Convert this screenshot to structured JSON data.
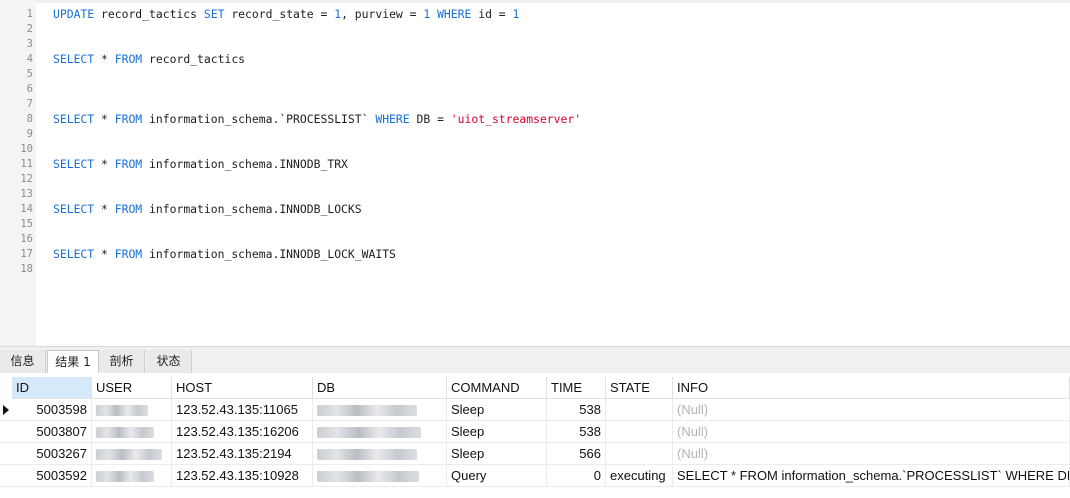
{
  "editor": {
    "lines": [
      {
        "n": "1",
        "tokens": [
          {
            "t": "UPDATE",
            "c": "kw"
          },
          {
            "t": " record_tactics ",
            "c": ""
          },
          {
            "t": "SET",
            "c": "kw"
          },
          {
            "t": " record_state = ",
            "c": ""
          },
          {
            "t": "1",
            "c": "num"
          },
          {
            "t": ", purview = ",
            "c": ""
          },
          {
            "t": "1",
            "c": "num"
          },
          {
            "t": " ",
            "c": ""
          },
          {
            "t": "WHERE",
            "c": "kw"
          },
          {
            "t": " id = ",
            "c": ""
          },
          {
            "t": "1",
            "c": "num"
          }
        ]
      },
      {
        "n": "2",
        "tokens": []
      },
      {
        "n": "3",
        "tokens": []
      },
      {
        "n": "4",
        "tokens": [
          {
            "t": "SELECT",
            "c": "kw"
          },
          {
            "t": " * ",
            "c": ""
          },
          {
            "t": "FROM",
            "c": "kw"
          },
          {
            "t": " record_tactics",
            "c": ""
          }
        ]
      },
      {
        "n": "5",
        "tokens": []
      },
      {
        "n": "6",
        "tokens": []
      },
      {
        "n": "7",
        "tokens": []
      },
      {
        "n": "8",
        "tokens": [
          {
            "t": "SELECT",
            "c": "kw"
          },
          {
            "t": " * ",
            "c": ""
          },
          {
            "t": "FROM",
            "c": "kw"
          },
          {
            "t": " information_schema.`PROCESSLIST` ",
            "c": ""
          },
          {
            "t": "WHERE",
            "c": "kw"
          },
          {
            "t": " DB = ",
            "c": ""
          },
          {
            "t": "'uiot_streamserver'",
            "c": "str"
          }
        ]
      },
      {
        "n": "9",
        "tokens": []
      },
      {
        "n": "10",
        "tokens": []
      },
      {
        "n": "11",
        "tokens": [
          {
            "t": "SELECT",
            "c": "kw"
          },
          {
            "t": " * ",
            "c": ""
          },
          {
            "t": "FROM",
            "c": "kw"
          },
          {
            "t": " information_schema.INNODB_TRX",
            "c": ""
          }
        ]
      },
      {
        "n": "12",
        "tokens": []
      },
      {
        "n": "13",
        "tokens": []
      },
      {
        "n": "14",
        "tokens": [
          {
            "t": "SELECT",
            "c": "kw"
          },
          {
            "t": " * ",
            "c": ""
          },
          {
            "t": "FROM",
            "c": "kw"
          },
          {
            "t": " information_schema.INNODB_LOCKS",
            "c": ""
          }
        ]
      },
      {
        "n": "15",
        "tokens": []
      },
      {
        "n": "16",
        "tokens": []
      },
      {
        "n": "17",
        "tokens": [
          {
            "t": "SELECT",
            "c": "kw"
          },
          {
            "t": " * ",
            "c": ""
          },
          {
            "t": "FROM",
            "c": "kw"
          },
          {
            "t": " information_schema.INNODB_LOCK_WAITS",
            "c": ""
          }
        ]
      },
      {
        "n": "18",
        "tokens": []
      }
    ]
  },
  "tabs": [
    {
      "label": "信息",
      "active": false
    },
    {
      "label": "结果 1",
      "active": true
    },
    {
      "label": "剖析",
      "active": false
    },
    {
      "label": "状态",
      "active": false
    }
  ],
  "grid": {
    "columns": [
      "ID",
      "USER",
      "HOST",
      "DB",
      "COMMAND",
      "TIME",
      "STATE",
      "INFO"
    ],
    "selected_column": "ID",
    "rows": [
      {
        "id": "5003598",
        "host": "123.52.43.135:11065",
        "command": "Sleep",
        "time": "538",
        "state": "",
        "info": "(Null)"
      },
      {
        "id": "5003807",
        "host": "123.52.43.135:16206",
        "command": "Sleep",
        "time": "538",
        "state": "",
        "info": "(Null)"
      },
      {
        "id": "5003267",
        "host": "123.52.43.135:2194",
        "command": "Sleep",
        "time": "566",
        "state": "",
        "info": "(Null)"
      },
      {
        "id": "5003592",
        "host": "123.52.43.135:10928",
        "command": "Query",
        "time": "0",
        "state": "executing",
        "info": "SELECT * FROM information_schema.`PROCESSLIST` WHERE DB = '"
      }
    ]
  },
  "colors": {
    "keyword": "#1a6fd6",
    "string": "#d8002f",
    "null": "#b4b4b4",
    "selected_header": "#d6e9fb"
  }
}
